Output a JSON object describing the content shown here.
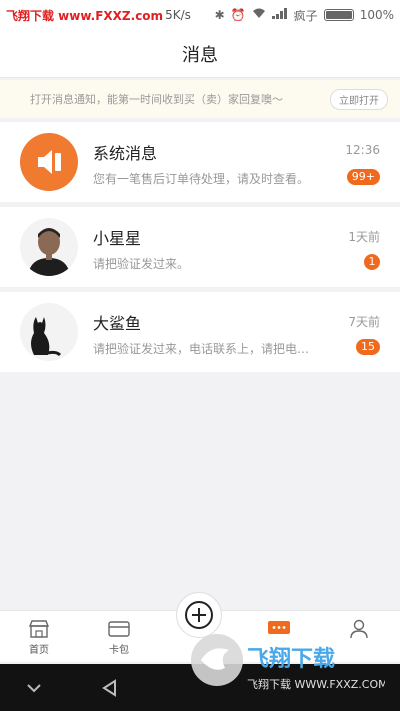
{
  "status_bar": {
    "watermark": "飞翔下载 www.FXXZ.com",
    "net_speed": "5K/s",
    "carrier": "疯子",
    "battery": "100%",
    "battery_level": 1.0
  },
  "header": {
    "title": "消息"
  },
  "notice": {
    "text": "打开消息通知，能第一时间收到买（卖）家回复噢～",
    "button": "立即打开"
  },
  "messages": [
    {
      "title": "系统消息",
      "subtitle": "您有一笔售后订单待处理，请及时查看。",
      "time": "12:36",
      "badge": "99+"
    },
    {
      "title": "小星星",
      "subtitle": "请把验证发过来。",
      "time": "1天前",
      "badge": "1"
    },
    {
      "title": "大鲨鱼",
      "subtitle": "请把验证发过来，电话联系上，请把电…",
      "time": "7天前",
      "badge": "15"
    }
  ],
  "tabbar": {
    "home": "首页",
    "cards": "卡包"
  },
  "watermark_bottom": "飞翔下载 WWW.FXXZ.COM",
  "colors": {
    "accent": "#f06a1e",
    "notice_bg": "#fdfaf0"
  }
}
